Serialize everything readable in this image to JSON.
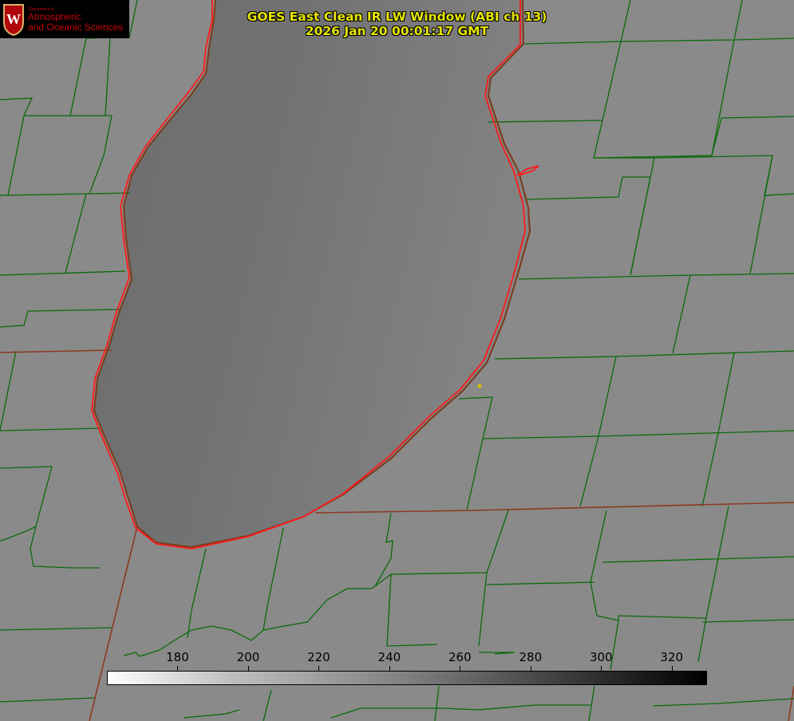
{
  "logo": {
    "dept": "Department of",
    "line1": "Atmospheric",
    "line2": "and Oceanic Sciences"
  },
  "title": {
    "line1": "GOES East Clean IR LW Window (ABI ch 13)",
    "line2": "2026 Jan 20 00:01:17 GMT"
  },
  "colorbar": {
    "min": 160,
    "max": 330,
    "ticks": [
      "180",
      "200",
      "220",
      "240",
      "260",
      "280",
      "300",
      "320"
    ],
    "cmap": "inverted grayscale (low = white, high = black)"
  },
  "colors": {
    "background": "#8a8a8a",
    "lake": "#6e6e6e",
    "county_border": "#006400",
    "coastline": "#ff0000",
    "title": "#e6e600",
    "logo_red": "#c5050c"
  }
}
